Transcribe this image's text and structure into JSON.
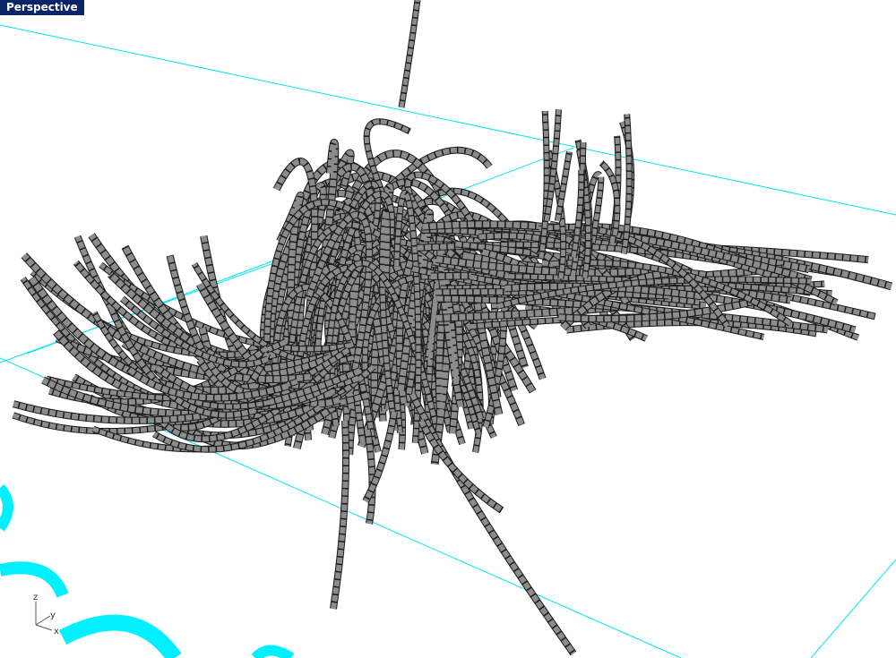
{
  "viewport": {
    "title": "Perspective",
    "title_bg": "#0a246a",
    "title_fg": "#ffffff",
    "background": "#ffffff",
    "grid_color": "#00e5f5",
    "ground_marks_color": "#00f0ff",
    "tube_fill": "#8c8c8c",
    "tube_edge": "#1a1a1a"
  },
  "axis_gizmo": {
    "z_label": "z",
    "y_label": "y",
    "x_label": "x"
  }
}
